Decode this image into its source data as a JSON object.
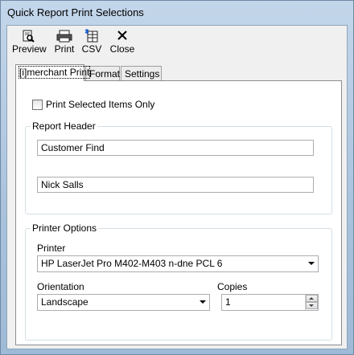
{
  "window": {
    "title": "Quick Report Print Selections"
  },
  "toolbar": {
    "items": [
      {
        "label": "Preview",
        "icon": "preview-icon"
      },
      {
        "label": "Print",
        "icon": "printer-icon"
      },
      {
        "label": "CSV",
        "icon": "csv-export-icon"
      },
      {
        "label": "Close",
        "icon": "close-icon"
      }
    ]
  },
  "tabs": [
    {
      "label": "[i]merchant Print",
      "active": true
    },
    {
      "label": "Format",
      "active": false
    },
    {
      "label": "Settings",
      "active": false
    }
  ],
  "print_selected": {
    "label": "Print Selected Items Only",
    "checked": false
  },
  "report_header": {
    "legend": "Report Header",
    "line1": "Customer Find",
    "line2": "Nick Salls"
  },
  "printer_options": {
    "legend": "Printer Options",
    "printer_label": "Printer",
    "printer_value": "HP LaserJet Pro M402-M403 n-dne PCL 6",
    "orientation_label": "Orientation",
    "orientation_value": "Landscape",
    "copies_label": "Copies",
    "copies_value": "1"
  }
}
